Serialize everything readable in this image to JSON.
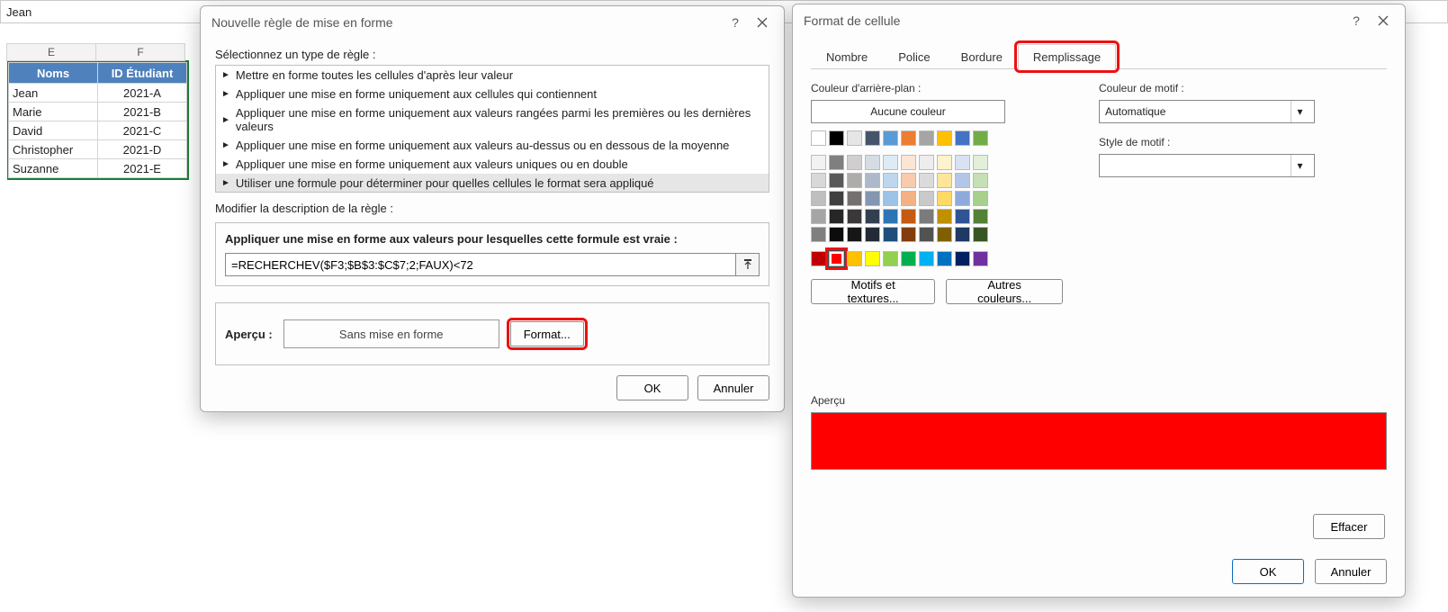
{
  "formula_bar": {
    "value": "Jean"
  },
  "sheet": {
    "col_headers": [
      "E",
      "F"
    ],
    "headers": [
      "Noms",
      "ID Étudiant"
    ],
    "rows": [
      {
        "name": "Jean",
        "id": "2021-A"
      },
      {
        "name": "Marie",
        "id": "2021-B"
      },
      {
        "name": "David",
        "id": "2021-C"
      },
      {
        "name": "Christopher",
        "id": "2021-D"
      },
      {
        "name": "Suzanne",
        "id": "2021-E"
      }
    ]
  },
  "rule_dialog": {
    "title": "Nouvelle règle de mise en forme",
    "select_label": "Sélectionnez un type de règle :",
    "rules": [
      "Mettre en forme toutes les cellules d'après leur valeur",
      "Appliquer une mise en forme uniquement aux cellules qui contiennent",
      "Appliquer une mise en forme uniquement aux valeurs rangées parmi les premières ou les dernières valeurs",
      "Appliquer une mise en forme uniquement aux valeurs au-dessus ou en dessous de la moyenne",
      "Appliquer une mise en forme uniquement aux valeurs uniques ou en double",
      "Utiliser une formule pour déterminer pour quelles cellules le format sera appliqué"
    ],
    "edit_label": "Modifier la description de la règle :",
    "edit_title": "Appliquer une mise en forme aux valeurs pour lesquelles cette formule est vraie :",
    "formula": "=RECHERCHEV($F3;$B$3:$C$7;2;FAUX)<72",
    "preview_label": "Aperçu :",
    "preview_text": "Sans mise en forme",
    "format_btn": "Format...",
    "ok": "OK",
    "cancel": "Annuler"
  },
  "format_dialog": {
    "title": "Format de cellule",
    "tabs": [
      "Nombre",
      "Police",
      "Bordure",
      "Remplissage"
    ],
    "bg_label": "Couleur d'arrière-plan :",
    "no_color": "Aucune couleur",
    "pattern_color_label": "Couleur de motif :",
    "pattern_color_value": "Automatique",
    "pattern_style_label": "Style de motif :",
    "more_fills": "Motifs et textures...",
    "more_colors": "Autres couleurs...",
    "preview_label": "Aperçu",
    "clear": "Effacer",
    "ok": "OK",
    "cancel": "Annuler",
    "theme_row1": [
      "#ffffff",
      "#000000",
      "#e7e6e6",
      "#44546a",
      "#5b9bd5",
      "#ed7d31",
      "#a5a5a5",
      "#ffc000",
      "#4472c4",
      "#70ad47"
    ],
    "tints": [
      [
        "#f2f2f2",
        "#7f7f7f",
        "#d0cece",
        "#d6dce4",
        "#deebf6",
        "#fbe5d5",
        "#ededed",
        "#fff2cc",
        "#d9e2f3",
        "#e2efd9"
      ],
      [
        "#d8d8d8",
        "#595959",
        "#aeabab",
        "#adb9ca",
        "#bdd7ee",
        "#f7cbac",
        "#dbdbdb",
        "#fee599",
        "#b4c6e7",
        "#c5e0b3"
      ],
      [
        "#bfbfbf",
        "#3f3f3f",
        "#757070",
        "#8496b0",
        "#9cc3e5",
        "#f4b183",
        "#c9c9c9",
        "#ffd965",
        "#8eaadb",
        "#a8d08d"
      ],
      [
        "#a5a5a5",
        "#262626",
        "#3a3838",
        "#323f4f",
        "#2e75b5",
        "#c55a11",
        "#7b7b7b",
        "#bf9000",
        "#2f5496",
        "#538135"
      ],
      [
        "#7f7f7f",
        "#0c0c0c",
        "#171616",
        "#222a35",
        "#1e4e79",
        "#833c0b",
        "#525252",
        "#7f6000",
        "#1f3864",
        "#375623"
      ]
    ],
    "standard": [
      "#c00000",
      "#ff0000",
      "#ffc000",
      "#ffff00",
      "#92d050",
      "#00b050",
      "#00b0f0",
      "#0070c0",
      "#002060",
      "#7030a0"
    ],
    "selected_color": "#ff0000"
  }
}
